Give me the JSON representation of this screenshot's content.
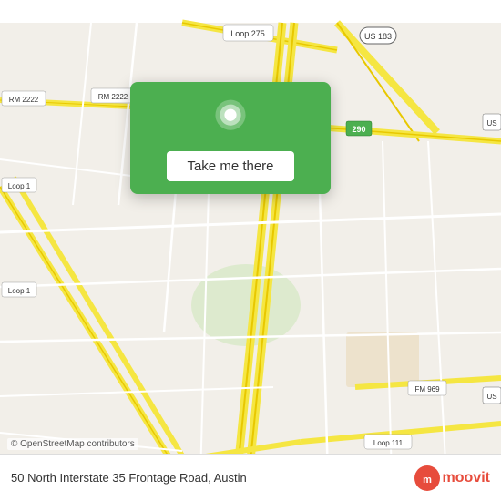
{
  "map": {
    "bg_color": "#f2efe9",
    "copyright": "© OpenStreetMap contributors"
  },
  "card": {
    "button_label": "Take me there",
    "bg_color": "#4caf50"
  },
  "bottom_bar": {
    "address": "50 North Interstate 35 Frontage Road, Austin",
    "logo": "moovit"
  },
  "route_labels": [
    "Loop 275",
    "US 183",
    "290",
    "US",
    "RM 2222",
    "RM 2222",
    "Loop 1",
    "Loop 1",
    "Loop 111",
    "FM 969",
    "US"
  ]
}
